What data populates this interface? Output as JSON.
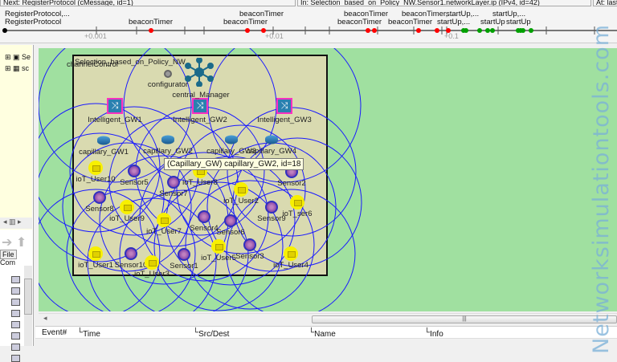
{
  "statusbar": {
    "next": "Next: RegisterProtocol (cMessage, id=1)",
    "in": "In: Selection_based_on_Policy_NW.Sensor1.networkLayer.ip (IPv4, id=42)",
    "at": "At: last ev"
  },
  "timeline": {
    "ticks": [
      "+0.001",
      "+0.01",
      "+0.1"
    ],
    "labels": [
      {
        "text": "RegisterProtocol,...",
        "row": 0
      },
      {
        "text": "RegisterProtocol",
        "row": 1
      },
      {
        "text": "beaconTimer",
        "row": 1
      },
      {
        "text": "beaconTimer",
        "row": 0
      },
      {
        "text": "beaconTimer",
        "row": 1
      },
      {
        "text": "beaconTimer",
        "row": 0
      },
      {
        "text": "beaconTimer",
        "row": 1
      },
      {
        "text": "beaconTimer,...",
        "row": 0
      },
      {
        "text": "beaconTimer",
        "row": 1
      },
      {
        "text": "startUp,...",
        "row": 0
      },
      {
        "text": "startUp,...",
        "row": 1
      },
      {
        "text": "startUp",
        "row": 1
      },
      {
        "text": "startUp,...",
        "row": 0
      },
      {
        "text": "startUp",
        "row": 1
      }
    ],
    "colors": {
      "message": "#ff0000",
      "self": "#00a000",
      "start": "#000000"
    }
  },
  "left_panel": {
    "tree_items": [
      "Se",
      "sc"
    ],
    "tab_labels": [
      "File",
      "Com"
    ]
  },
  "network": {
    "title": "Selection_based_on_Policy_NW",
    "channel_control": "channelControl",
    "configurator": "configurator",
    "manager": "central_Manager",
    "intelligent_gateways": [
      "Intelligent_GW1",
      "Intelligent_GW2",
      "Intelligent_GW3"
    ],
    "capillary_gateways": [
      "capillary_GW1",
      "capillary_GW2",
      "capillary_GW3",
      "capillary_GW4"
    ],
    "sensors": [
      "Sensor5",
      "Sensor7",
      "Sensor2",
      "Sensor8",
      "Sensor4",
      "Sensor6",
      "Sensor9",
      "Sensor10",
      "Sensor1",
      "Sensor3"
    ],
    "iot_users": [
      "ioT_User10",
      "ioT_User8",
      "ioT_User2",
      "ioT_ser6",
      "ioT_User9",
      "ioT_User7",
      "ioT_User1",
      "ioT_User3",
      "ioT_User5",
      "ioT_User4"
    ],
    "tooltip": "(Capillary_GW) capillary_GW2, id=18",
    "range_color": "#1a1aff",
    "background_color": "#a0e0a0"
  },
  "log": {
    "columns": [
      "Event#",
      "Time",
      "Src/Dest",
      "Name",
      "Info"
    ]
  },
  "watermark": "Networksimulationtools.com"
}
